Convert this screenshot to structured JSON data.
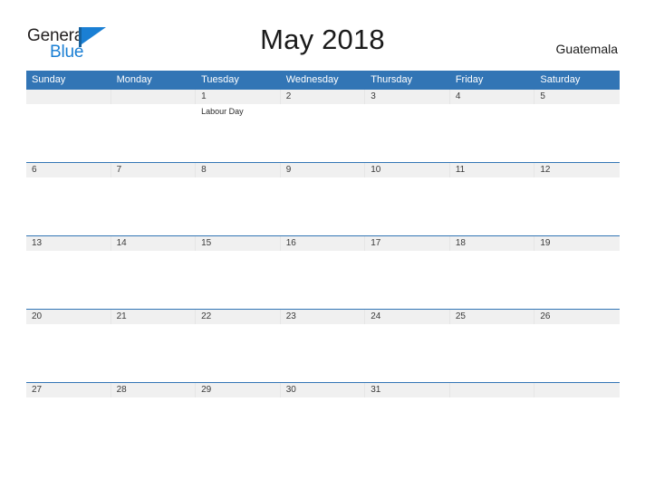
{
  "brand": {
    "name_top": "General",
    "name_bottom": "Blue",
    "mark": "triangle-logo-mark",
    "color_dark": "#221f1f",
    "color_blue": "#1a7fd4"
  },
  "header": {
    "title": "May 2018",
    "country": "Guatemala"
  },
  "theme": {
    "header_blue": "#3275b5",
    "number_band_gray": "#f0f0f0",
    "grid_line": "#e6e6e6",
    "page_background": "#ffffff"
  },
  "calendar": {
    "weekdays": [
      "Sunday",
      "Monday",
      "Tuesday",
      "Wednesday",
      "Thursday",
      "Friday",
      "Saturday"
    ],
    "weeks": [
      {
        "numbers": [
          "",
          "",
          "1",
          "2",
          "3",
          "4",
          "5"
        ],
        "events": [
          "",
          "",
          "Labour Day",
          "",
          "",
          "",
          ""
        ]
      },
      {
        "numbers": [
          "6",
          "7",
          "8",
          "9",
          "10",
          "11",
          "12"
        ],
        "events": [
          "",
          "",
          "",
          "",
          "",
          "",
          ""
        ]
      },
      {
        "numbers": [
          "13",
          "14",
          "15",
          "16",
          "17",
          "18",
          "19"
        ],
        "events": [
          "",
          "",
          "",
          "",
          "",
          "",
          ""
        ]
      },
      {
        "numbers": [
          "20",
          "21",
          "22",
          "23",
          "24",
          "25",
          "26"
        ],
        "events": [
          "",
          "",
          "",
          "",
          "",
          "",
          ""
        ]
      },
      {
        "numbers": [
          "27",
          "28",
          "29",
          "30",
          "31",
          "",
          ""
        ],
        "events": [
          "",
          "",
          "",
          "",
          "",
          "",
          ""
        ]
      }
    ]
  }
}
